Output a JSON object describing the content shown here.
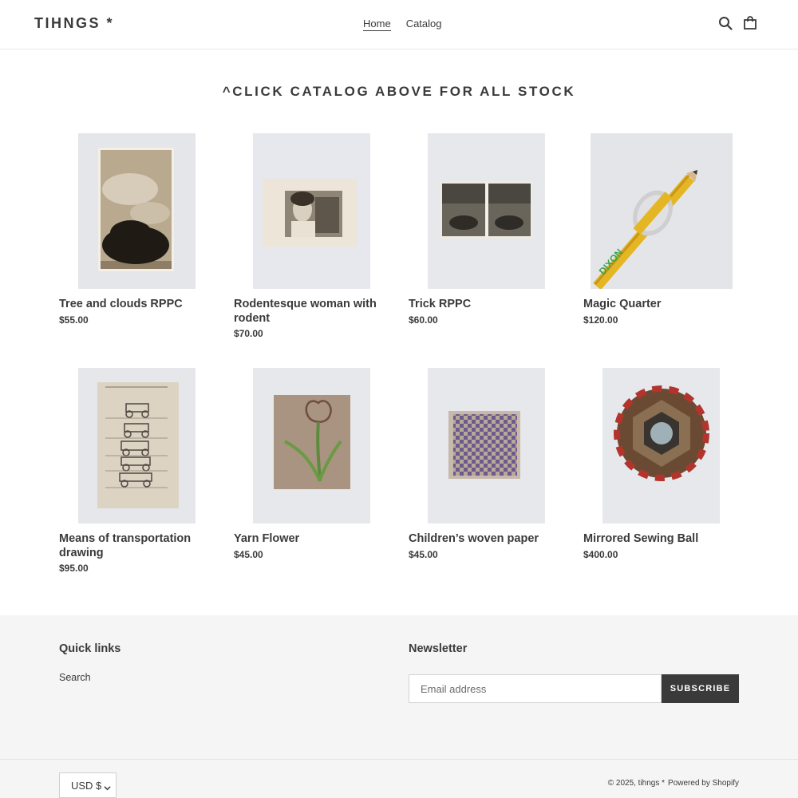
{
  "header": {
    "logo": "TIHNGS *",
    "nav": [
      {
        "label": "Home",
        "active": true
      },
      {
        "label": "Catalog",
        "active": false
      }
    ],
    "icons": [
      "search-icon",
      "cart-icon"
    ]
  },
  "section": {
    "title": "^CLICK CATALOG ABOVE FOR ALL STOCK"
  },
  "products": [
    {
      "title": "Tree and clouds RPPC",
      "price": "$55.00"
    },
    {
      "title": "Rodentesque woman with rodent",
      "price": "$70.00"
    },
    {
      "title": "Trick RPPC",
      "price": "$60.00"
    },
    {
      "title": "Magic Quarter",
      "price": "$120.00"
    },
    {
      "title": "Means of transportation drawing",
      "price": "$95.00"
    },
    {
      "title": "Yarn Flower",
      "price": "$45.00"
    },
    {
      "title": "Children’s woven paper",
      "price": "$45.00"
    },
    {
      "title": "Mirrored Sewing Ball",
      "price": "$400.00"
    }
  ],
  "footer": {
    "quick_links_heading": "Quick links",
    "links": [
      "Search"
    ],
    "newsletter_heading": "Newsletter",
    "email_placeholder": "Email address",
    "subscribe_label": "SUBSCRIBE",
    "currency": "USD $",
    "copyright": "© 2025, tihngs *",
    "powered_by": "Powered by Shopify"
  },
  "colors": {
    "text": "#3a3a3a",
    "footer_bg": "#f5f5f5",
    "button_bg": "#3a3a3a"
  }
}
